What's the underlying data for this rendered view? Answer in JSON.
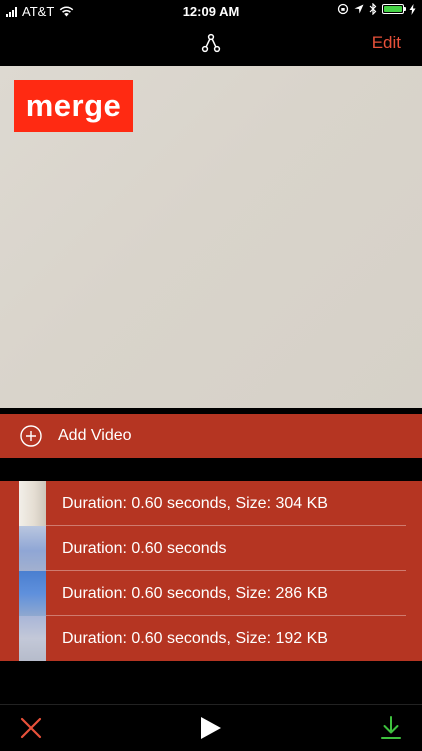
{
  "status_bar": {
    "carrier": "AT&T",
    "time": "12:09 AM"
  },
  "nav_bar": {
    "center_icon": "merge-icon",
    "edit_label": "Edit"
  },
  "preview": {
    "logo_text": "merge"
  },
  "add_video": {
    "label": "Add Video",
    "icon": "plus-circle-icon"
  },
  "clips": [
    {
      "label": "Duration: 0.60 seconds,  Size: 304 KB"
    },
    {
      "label": "Duration: 0.60 seconds"
    },
    {
      "label": "Duration: 0.60 seconds,  Size: 286 KB"
    },
    {
      "label": "Duration: 0.60 seconds,  Size: 192 KB"
    }
  ],
  "toolbar": {
    "delete_icon": "close-icon",
    "play_icon": "play-icon",
    "export_icon": "download-icon"
  },
  "colors": {
    "accent": "#e8513a",
    "row_bg": "#b53522",
    "logo_bg": "#ff2a12",
    "export": "#3ec23e"
  }
}
